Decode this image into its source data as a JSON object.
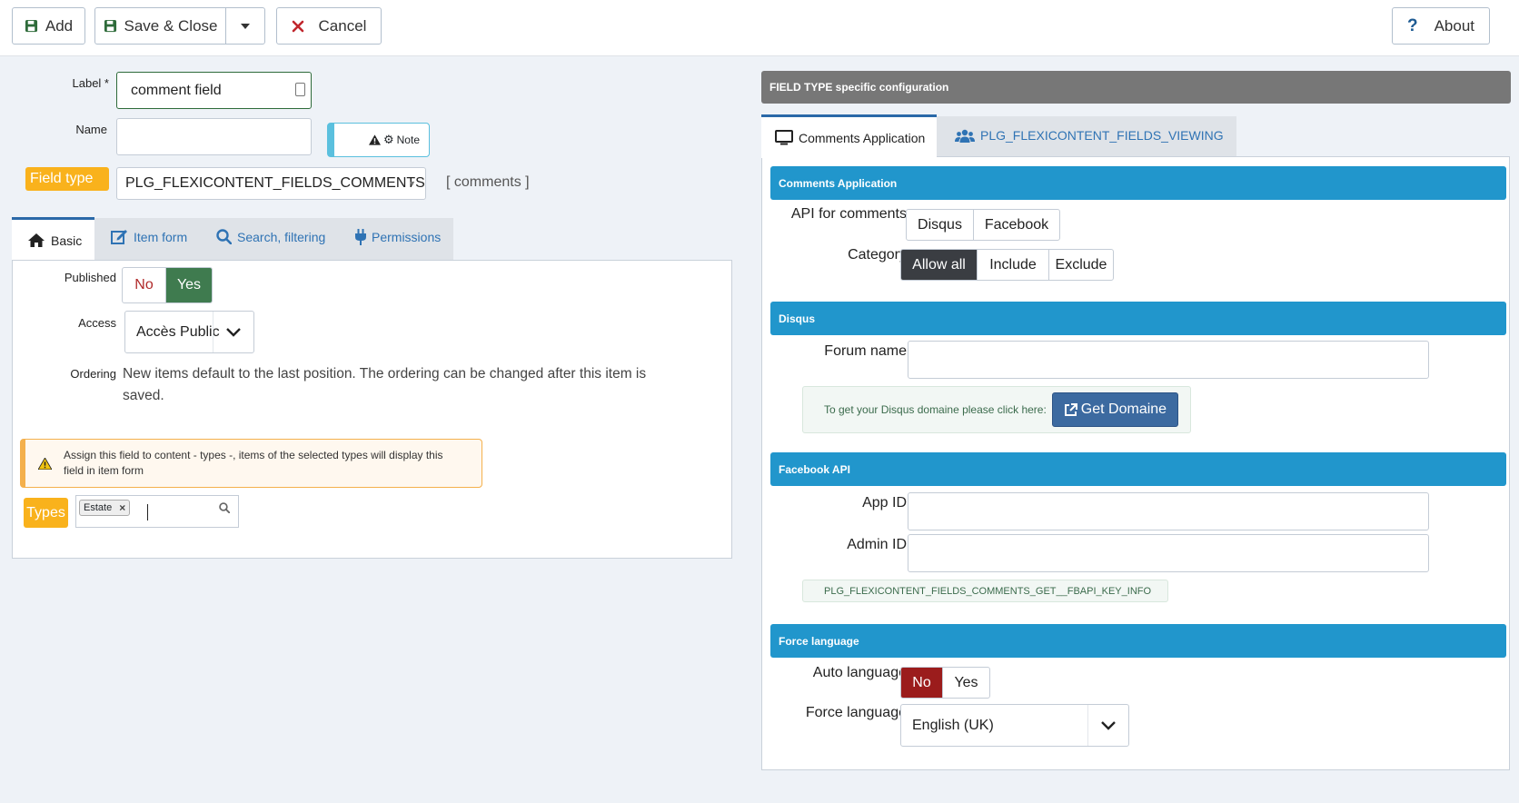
{
  "toolbar": {
    "add_label": "Add",
    "save_close_label": "Save & Close",
    "cancel_label": "Cancel",
    "about_label": "About"
  },
  "form": {
    "label_label": "Label *",
    "label_value": "comment field",
    "name_label": "Name",
    "name_value": "",
    "note_label": "Note",
    "field_type_label": "Field type",
    "field_type_value": "PLG_FLEXICONTENT_FIELDS_COMMENTS",
    "field_type_code": "[ comments ]"
  },
  "left_tabs": [
    {
      "label": "Basic",
      "icon": "home-icon"
    },
    {
      "label": "Item form",
      "icon": "edit-icon"
    },
    {
      "label": "Search, filtering",
      "icon": "search-icon"
    },
    {
      "label": "Permissions",
      "icon": "plug-icon"
    }
  ],
  "basic": {
    "published_label": "Published",
    "published_no": "No",
    "published_yes": "Yes",
    "access_label": "Access",
    "access_value": "Accès Public",
    "ordering_label": "Ordering",
    "ordering_text": "New items default to the last position. The ordering can be changed after this item is saved.",
    "warning_text": "Assign this field to content - types -, items of the selected types will display this field in item form",
    "types_label": "Types",
    "types_tag": "Estate"
  },
  "right": {
    "header": "FIELD TYPE specific configuration",
    "tabs": [
      {
        "label": "Comments Application",
        "icon": "monitor-icon"
      },
      {
        "label": "PLG_FLEXICONTENT_FIELDS_VIEWING",
        "icon": "users-icon"
      }
    ],
    "sections": {
      "comments_app": "Comments Application",
      "disqus": "Disqus",
      "facebook_api": "Facebook API",
      "force_language": "Force language"
    },
    "api_label": "API for comments",
    "api_options": [
      "Disqus",
      "Facebook"
    ],
    "category_label": "Category",
    "category_options": [
      "Allow all",
      "Include",
      "Exclude"
    ],
    "forum_name_label": "Forum name",
    "disqus_info": "To get your Disqus domaine please click here:",
    "get_domaine_label": "Get Domaine",
    "app_id_label": "App ID",
    "admin_id_label": "Admin ID",
    "fbapi_info": "PLG_FLEXICONTENT_FIELDS_COMMENTS_GET__FBAPI_KEY_INFO",
    "auto_language_label": "Auto language",
    "auto_language_no": "No",
    "auto_language_yes": "Yes",
    "force_language_label": "Force language",
    "force_language_value": "English (UK)"
  },
  "colors": {
    "accent_blue": "#2196cc",
    "orange": "#f9b21c",
    "green_yes": "#3f7b4f",
    "red_no": "#9b1c1c",
    "dark_button": "#3a3d42",
    "domaine_button": "#3c6aa0"
  }
}
